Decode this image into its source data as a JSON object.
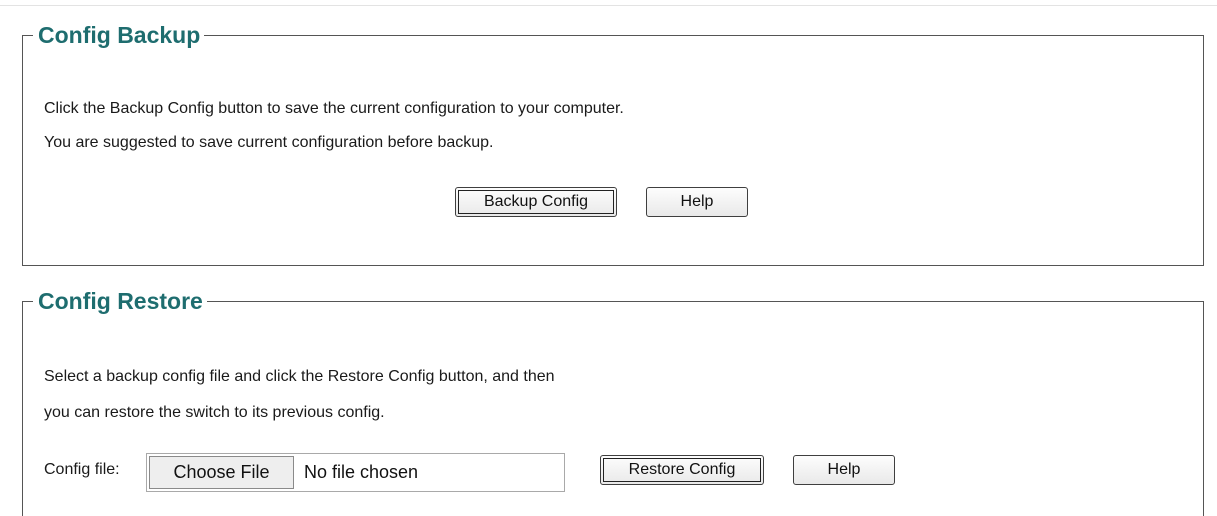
{
  "backup": {
    "title": "Config Backup",
    "line1": "Click the Backup Config button to save the current configuration to your computer.",
    "line2": "You are suggested to save current configuration before backup.",
    "backup_button": "Backup Config",
    "help_button": "Help"
  },
  "restore": {
    "title": "Config Restore",
    "line1": "Select a backup config file and click the Restore Config button, and then",
    "line2": "you can restore the switch to its previous config.",
    "file_label": "Config file:",
    "choose_file_button": "Choose File",
    "file_status": "No file chosen",
    "restore_button": "Restore Config",
    "help_button": "Help"
  },
  "colors": {
    "title": "#1e6d6f",
    "border": "#555555"
  }
}
